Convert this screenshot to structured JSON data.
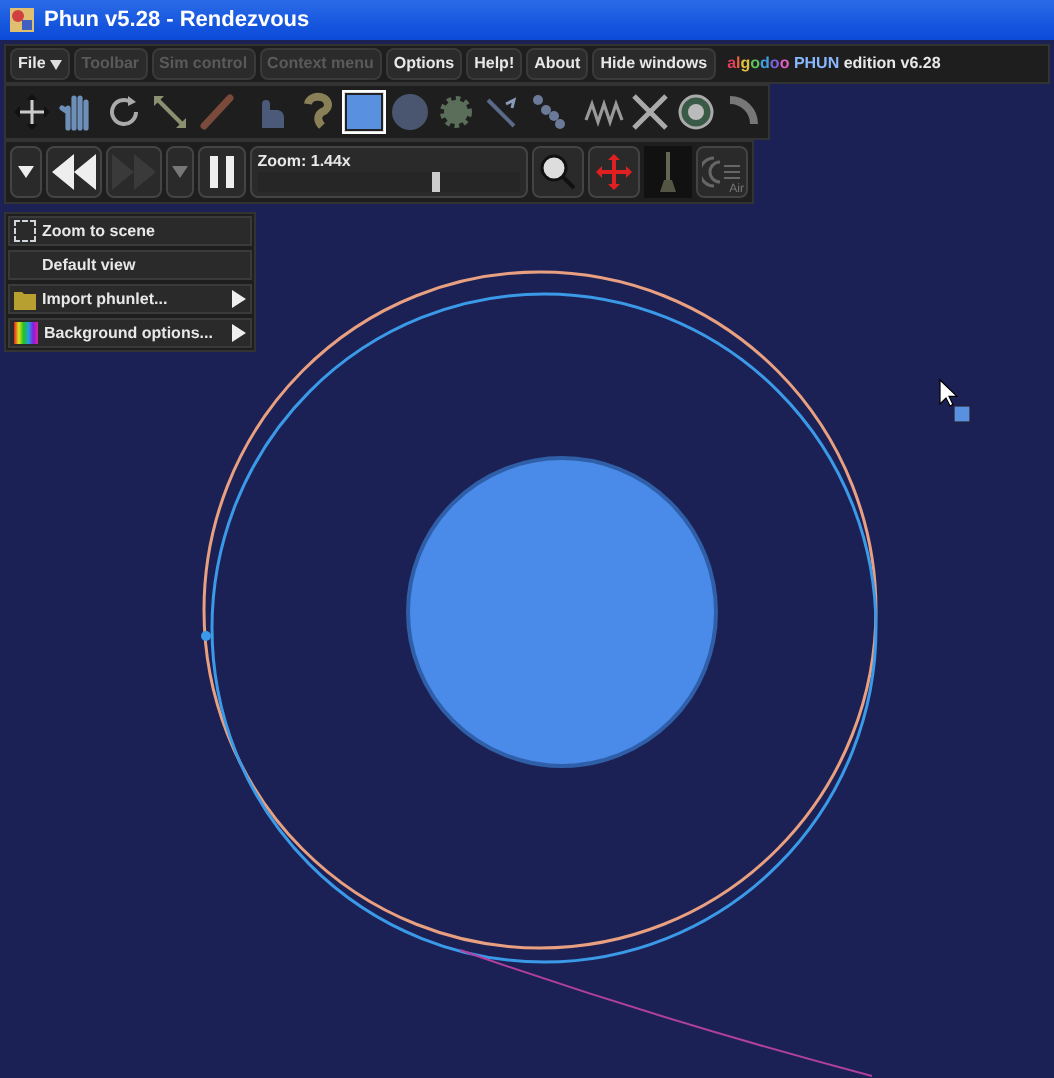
{
  "window": {
    "title": "Phun v5.28 - Rendezvous"
  },
  "menu_bar": [
    {
      "label": "File",
      "dropdown": true,
      "disabled": false
    },
    {
      "label": "Toolbar",
      "dropdown": false,
      "disabled": true
    },
    {
      "label": "Sim control",
      "dropdown": false,
      "disabled": true
    },
    {
      "label": "Context menu",
      "dropdown": false,
      "disabled": true
    },
    {
      "label": "Options",
      "dropdown": false,
      "disabled": false
    },
    {
      "label": "Help!",
      "dropdown": false,
      "disabled": false
    },
    {
      "label": "About",
      "dropdown": false,
      "disabled": false
    },
    {
      "label": "Hide windows",
      "dropdown": false,
      "disabled": false
    }
  ],
  "brand": {
    "prefix": "algodoo",
    "name": "PHUN",
    "suffix": "edition v6.28"
  },
  "tools": [
    {
      "kind": "move",
      "selected": false
    },
    {
      "kind": "drag",
      "selected": false
    },
    {
      "kind": "rotate",
      "selected": false
    },
    {
      "kind": "scale",
      "selected": false
    },
    {
      "kind": "cut",
      "selected": false
    },
    {
      "kind": "sketch",
      "selected": false
    },
    {
      "kind": "polygon",
      "selected": false
    },
    {
      "kind": "box",
      "selected": true
    },
    {
      "kind": "circle",
      "selected": false
    },
    {
      "kind": "gear",
      "selected": false
    },
    {
      "kind": "fixate",
      "selected": false
    },
    {
      "kind": "chain",
      "selected": false
    },
    {
      "kind": "spring",
      "selected": false
    },
    {
      "kind": "hinge",
      "selected": false
    },
    {
      "kind": "axle",
      "selected": false
    },
    {
      "kind": "laser",
      "selected": false
    }
  ],
  "sim_control": {
    "zoom_label": "Zoom: 1.44x",
    "zoom": {
      "level": 0.68
    },
    "air_label": "Air",
    "forward_disabled": true
  },
  "context_menu": [
    {
      "kind": "zoom",
      "label": "Zoom to scene",
      "submenu": false
    },
    {
      "kind": "plain",
      "label": "Default view",
      "submenu": false
    },
    {
      "kind": "folder",
      "label": "Import phunlet...",
      "submenu": true
    },
    {
      "kind": "colors",
      "label": "Background options...",
      "submenu": true
    }
  ]
}
